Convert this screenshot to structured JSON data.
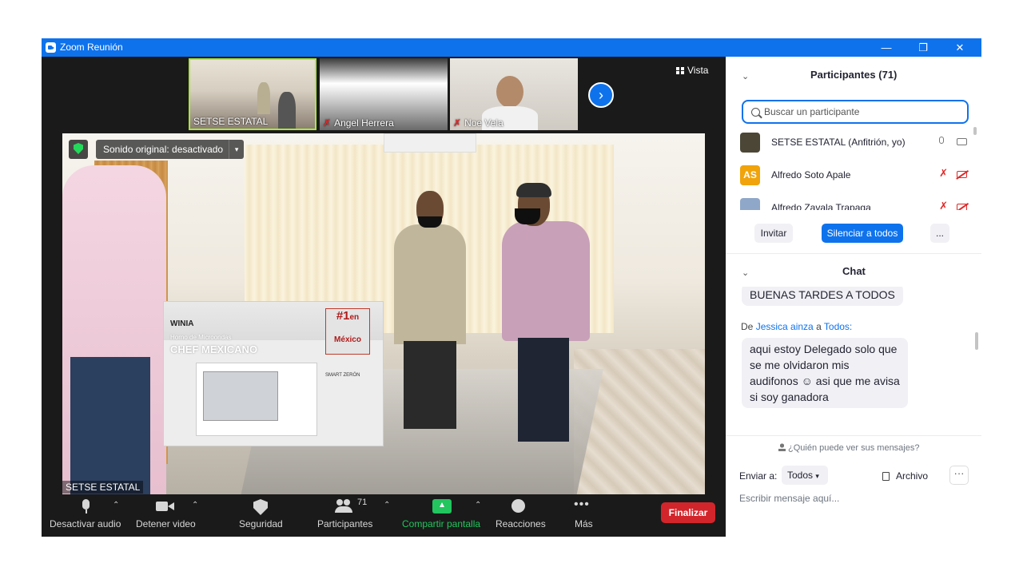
{
  "window": {
    "title": "Zoom Reunión"
  },
  "gallery": {
    "tiles": [
      {
        "name": "SETSE ESTATAL",
        "muted": false
      },
      {
        "name": "Angel Herrera",
        "muted": true
      },
      {
        "name": "Noe Vela",
        "muted": true
      }
    ],
    "view_label": "Vista"
  },
  "main_video": {
    "original_sound": "Sonido original: desactivado",
    "speaker_name": "SETSE ESTATAL",
    "box": {
      "brand": "WINIA",
      "subtitle": "Horno de Microondas",
      "model": "CHEF MEXICANO",
      "badge_line1": "#1",
      "badge_line2": "en",
      "badge_line3": "México",
      "feature": "SMART ZERÓN"
    }
  },
  "toolbar": {
    "mute": "Desactivar audio",
    "video": "Detener video",
    "security": "Seguridad",
    "participants": "Participantes",
    "participants_count": "71",
    "share": "Compartir pantalla",
    "reactions": "Reacciones",
    "more": "Más",
    "end": "Finalizar",
    "share_color": "#22c55e",
    "end_color": "#d2252b"
  },
  "participants_panel": {
    "title": "Participantes (71)",
    "search_placeholder": "Buscar un participante",
    "list": [
      {
        "name": "SETSE ESTATAL (Anfitrión, yo)",
        "initials": "",
        "avatar_color": "#4b4636",
        "mic": "on",
        "cam": "on"
      },
      {
        "name": "Alfredo Soto Apale",
        "initials": "AS",
        "avatar_color": "#f0a30a",
        "mic": "off",
        "cam": "off"
      },
      {
        "name": "Alfredo Zavala Trapaga",
        "initials": "",
        "avatar_color": "#8fa7c9",
        "mic": "off",
        "cam": "off"
      }
    ],
    "invite": "Invitar",
    "mute_all": "Silenciar a todos",
    "more": "..."
  },
  "chat": {
    "title": "Chat",
    "messages": [
      {
        "text": "BUENAS TARDES A TODOS"
      },
      {
        "from_prefix": "De",
        "sender": "Jessica ainza",
        "to_word": "a",
        "recipient": "Todos:",
        "text_lines": [
          "aqui estoy Delegado solo que",
          "se me olvidaron mis",
          "audifonos ☺ asi que me avisa",
          "si soy ganadora"
        ]
      }
    ],
    "visibility_note": "¿Quién puede ver sus mensajes?",
    "send_to_label": "Enviar a:",
    "send_to_value": "Todos",
    "file_label": "Archivo",
    "more": "···",
    "input_placeholder": "Escribir mensaje aquí..."
  }
}
